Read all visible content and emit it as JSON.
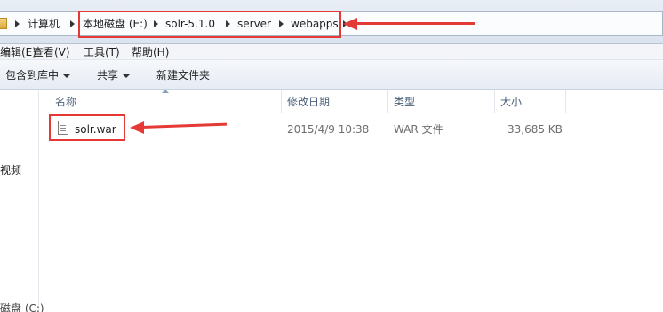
{
  "address_bar": {
    "crumbs": [
      "计算机",
      "本地磁盘 (E:)",
      "solr-5.1.0",
      "server",
      "webapps"
    ]
  },
  "menubar": {
    "items": [
      "编辑(E)",
      "查看(V)",
      "工具(T)",
      "帮助(H)"
    ]
  },
  "toolbar": {
    "include_in_library": "包含到库中",
    "share": "共享",
    "new_folder": "新建文件夹"
  },
  "nav": {
    "videos": "视频",
    "local_disk_c": "磁盘 (C:)"
  },
  "columns": {
    "name": "名称",
    "modified": "修改日期",
    "type": "类型",
    "size": "大小"
  },
  "files": [
    {
      "name": "solr.war",
      "modified": "2015/4/9 10:38",
      "type": "WAR 文件",
      "size": "33,685 KB",
      "icon": "document-icon"
    }
  ],
  "annotations": {
    "color": "#e53935"
  }
}
